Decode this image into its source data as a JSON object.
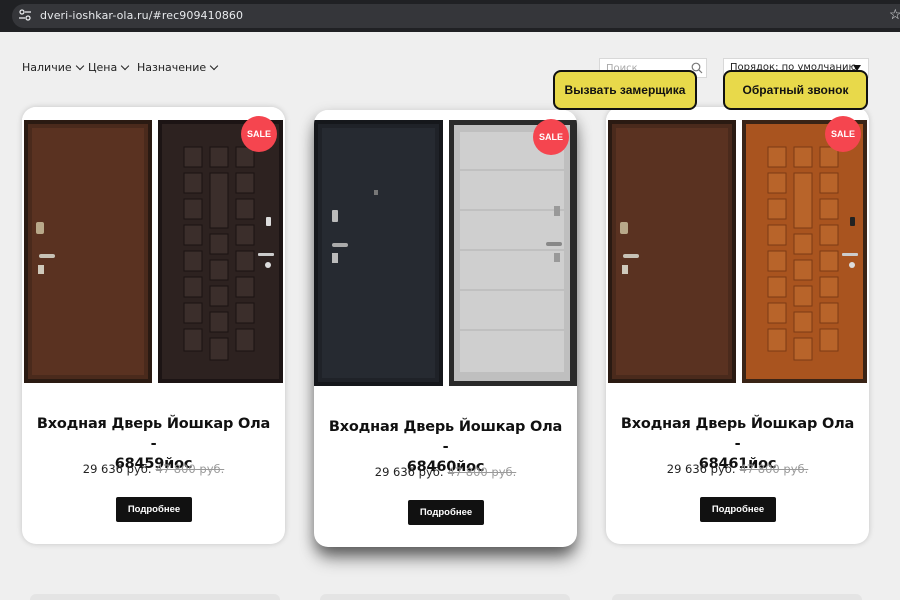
{
  "browser": {
    "url": "dveri-ioshkar-ola.ru/#rec909410860"
  },
  "filters": {
    "availability": "Наличие",
    "price": "Цена",
    "purpose": "Назначение"
  },
  "search": {
    "placeholder": "Поиск"
  },
  "sort": {
    "value": "Порядок: по умолчанию"
  },
  "floating_buttons": {
    "measurer": "Вызвать замерщика",
    "callback": "Обратный звонок"
  },
  "products": [
    {
      "badge": "SALE",
      "title_line1": "Входная Дверь Йошкар Ола -",
      "title_line2": "68459йос",
      "price": "29 636 руб.",
      "old_price": "47 800 руб.",
      "button": "Подробнее"
    },
    {
      "badge": "SALE",
      "title_line1": "Входная Дверь Йошкар Ола -",
      "title_line2": "68460йос",
      "price": "29 636 руб.",
      "old_price": "47 800 руб.",
      "button": "Подробнее"
    },
    {
      "badge": "SALE",
      "title_line1": "Входная Дверь Йошкар Ола -",
      "title_line2": "68461йос",
      "price": "29 636 руб.",
      "old_price": "47 800 руб.",
      "button": "Подробнее"
    }
  ]
}
